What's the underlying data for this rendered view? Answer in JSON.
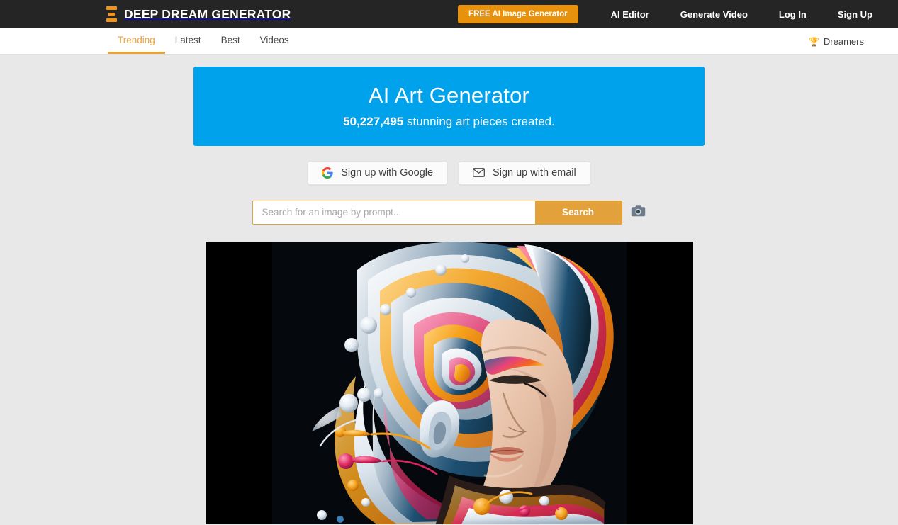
{
  "header": {
    "logo_icon": "hourglass-logo-icon",
    "brand": "DEEP DREAM GENERATOR",
    "cta_label": "FREE AI Image Generator",
    "links": [
      {
        "label": "AI Editor"
      },
      {
        "label": "Generate Video"
      },
      {
        "label": "Log In"
      },
      {
        "label": "Sign Up"
      }
    ]
  },
  "subnav": {
    "tabs": [
      {
        "label": "Trending",
        "active": true
      },
      {
        "label": "Latest",
        "active": false
      },
      {
        "label": "Best",
        "active": false
      },
      {
        "label": "Videos",
        "active": false
      }
    ],
    "dreamers_label": "Dreamers",
    "trophy_icon": "trophy-icon"
  },
  "banner": {
    "title": "AI Art Generator",
    "count": "50,227,495",
    "subtitle_rest": " stunning art pieces created."
  },
  "signup": {
    "google_label": "Sign up with Google",
    "email_label": "Sign up with email",
    "google_icon": "google-g-icon",
    "email_icon": "envelope-icon"
  },
  "search": {
    "placeholder": "Search for an image by prompt...",
    "value": "",
    "submit_label": "Search",
    "camera_icon": "camera-icon"
  },
  "artwork": {
    "alt": "AI generated portrait of a woman with flowing colorful swirling hair"
  },
  "colors": {
    "header_bg": "#252525",
    "accent_orange": "#e8910c",
    "tab_orange": "#e8a33d",
    "banner_blue": "#00a2ec",
    "page_bg": "#e8e8e8",
    "search_orange": "#e3a13c"
  }
}
